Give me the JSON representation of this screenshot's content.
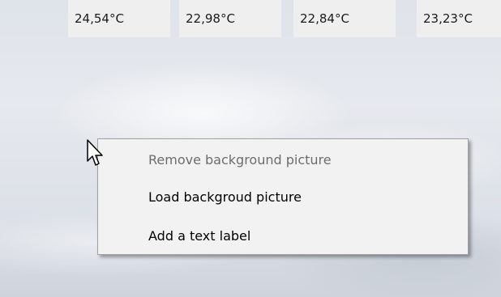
{
  "temperatures": [
    {
      "value": "24,54°C"
    },
    {
      "value": "22,98°C"
    },
    {
      "value": "22,84°C"
    },
    {
      "value": "23,23°C"
    }
  ],
  "context_menu": {
    "items": [
      {
        "label": "Remove background picture",
        "enabled": false
      },
      {
        "label": "Load backgroud picture",
        "enabled": true
      },
      {
        "label": "Add a text label",
        "enabled": true
      }
    ]
  },
  "icons": {
    "cursor": "arrow-cursor-icon"
  },
  "colors": {
    "menu_background": "#f2f2f2",
    "disabled_text": "#6d6d6d",
    "enabled_text": "#000000"
  }
}
